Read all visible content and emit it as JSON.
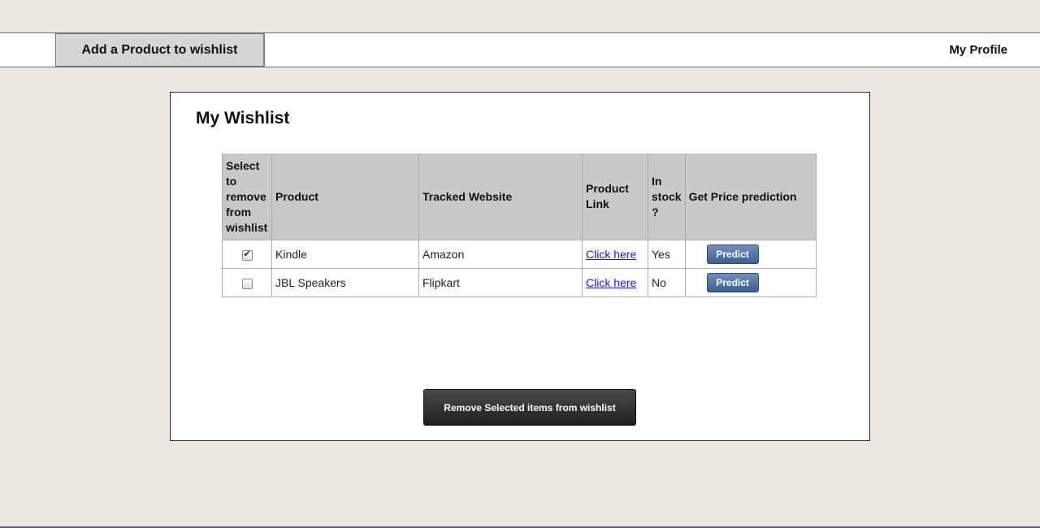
{
  "nav": {
    "add_product_label": "Add a Product to wishlist",
    "my_profile_label": "My Profile"
  },
  "wishlist": {
    "title": "My Wishlist",
    "columns": [
      "Select to remove from wishlist",
      "Product",
      "Tracked Website",
      "Product Link",
      "In stock ?",
      "Get Price prediction"
    ],
    "rows": [
      {
        "selected": true,
        "product": "Kindle",
        "website": "Amazon",
        "link_label": "Click here",
        "in_stock": "Yes",
        "predict_label": "Predict"
      },
      {
        "selected": false,
        "product": "JBL Speakers",
        "website": "Flipkart",
        "link_label": "Click here",
        "in_stock": "No",
        "predict_label": "Predict"
      }
    ],
    "remove_button_label": "Remove Selected items from wishlist"
  },
  "colors": {
    "background": "#ece9e3",
    "predict_button": "#4b6a9b",
    "remove_button": "#2a2a2a",
    "link": "#1a1ae6"
  }
}
